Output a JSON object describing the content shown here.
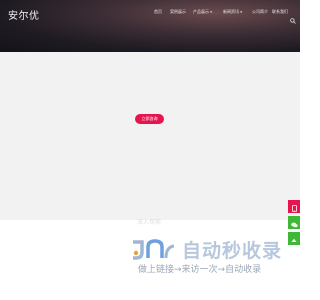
{
  "brand": {
    "name": "安尔优"
  },
  "nav": {
    "items": [
      {
        "label": "首页",
        "has_dropdown": false
      },
      {
        "label": "案例展示",
        "has_dropdown": false
      },
      {
        "label": "产品展示",
        "has_dropdown": true
      },
      {
        "label": "新闻资讯",
        "has_dropdown": true
      },
      {
        "label": "公司简介",
        "has_dropdown": false
      },
      {
        "label": "联系我们",
        "has_dropdown": false
      }
    ],
    "search_icon": "search-icon"
  },
  "hero": {
    "cta_label": "立即咨询"
  },
  "overlay": {
    "text": "深入探索"
  },
  "side_tools": [
    {
      "icon": "phone-icon",
      "color": "#e6154f"
    },
    {
      "icon": "wechat-icon",
      "color": "#3fb837"
    },
    {
      "icon": "arrow-up-icon",
      "color": "#3fb837"
    }
  ],
  "watermark": {
    "title": "自动秒收录",
    "subtitle": "做上链接→来访一次→自动收录"
  },
  "colors": {
    "accent": "#e6154f",
    "hero_dark": "#1f1b22",
    "body_bg": "#f2f2f2"
  }
}
